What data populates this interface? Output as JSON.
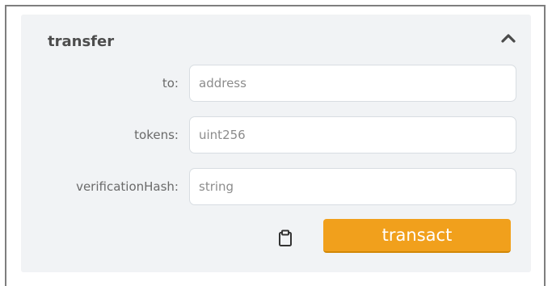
{
  "function_card": {
    "title": "transfer",
    "collapse_icon": "chevron-up-icon",
    "inputs": [
      {
        "label": "to:",
        "placeholder": "address",
        "value": ""
      },
      {
        "label": "tokens:",
        "placeholder": "uint256",
        "value": ""
      },
      {
        "label": "verificationHash:",
        "placeholder": "string",
        "value": ""
      }
    ],
    "clipboard_icon": "clipboard-icon",
    "transact_label": "transact"
  },
  "colors": {
    "panel_background": "#f1f3f5",
    "button_orange": "#f1a01c",
    "label_text": "#6a6a6a",
    "title_text": "#4d4d4d"
  }
}
